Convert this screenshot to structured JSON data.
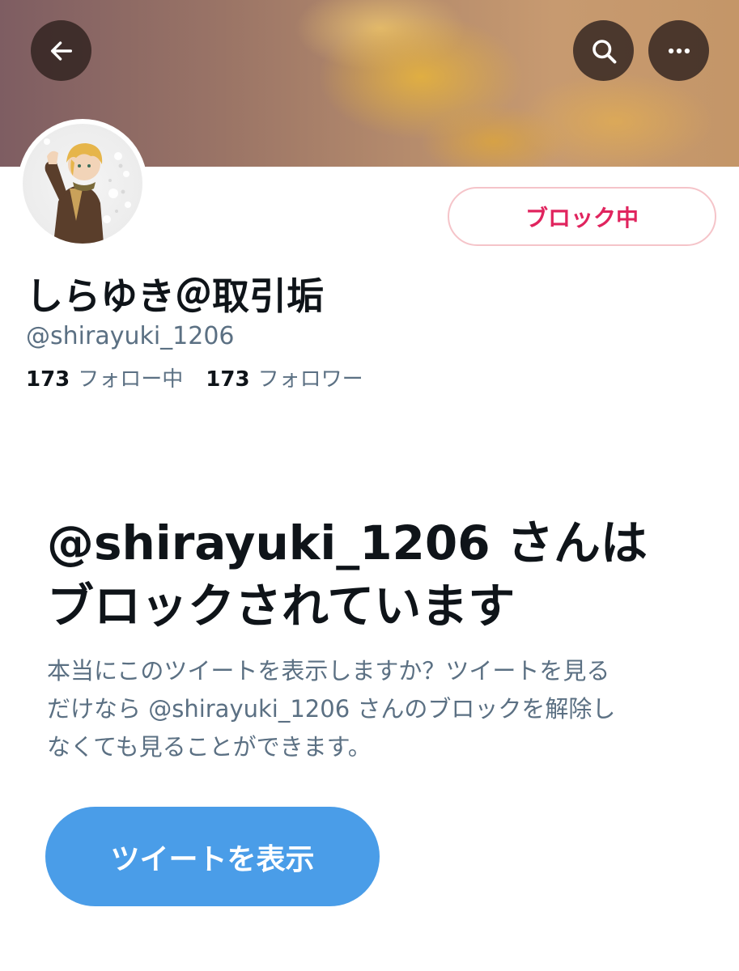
{
  "header": {
    "back_icon": "arrow-left-icon",
    "search_icon": "search-icon",
    "more_icon": "more-horizontal-icon",
    "overlay_color": "#30221e"
  },
  "profile": {
    "display_name": "しらゆき＠取引垢",
    "handle": "@shirayuki_1206",
    "following_count": "173",
    "following_label": "フォロー中",
    "followers_count": "173",
    "followers_label": "フォロワー",
    "block_button_label": "ブロック中",
    "block_color": "#e0245e"
  },
  "blocked_notice": {
    "title_line1": "@shirayuki_1206 さんは",
    "title_line2": "ブロックされています",
    "description_line1": "本当にこのツイートを表示しますか？ツイートを見る",
    "description_line2": "だけなら @shirayuki_1206 さんのブロックを解除し",
    "description_line3": "なくても見ることができます。",
    "view_button_label": "ツイートを表示",
    "view_button_color": "#4a9de8"
  }
}
